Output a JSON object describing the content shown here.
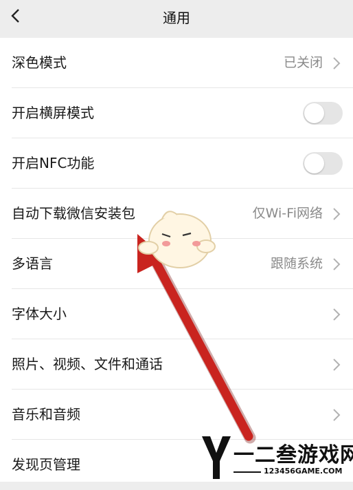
{
  "nav": {
    "title": "通用"
  },
  "rows": [
    {
      "label": "深色模式",
      "value": "已关闭",
      "control": "chevron"
    },
    {
      "label": "开启横屏模式",
      "control": "toggle",
      "toggle_on": false
    },
    {
      "label": "开启NFC功能",
      "control": "toggle",
      "toggle_on": false
    },
    {
      "label": "自动下载微信安装包",
      "value": "仅Wi-Fi网络",
      "control": "chevron"
    },
    {
      "label": "多语言",
      "value": "跟随系统",
      "control": "chevron"
    },
    {
      "label": "字体大小",
      "control": "chevron"
    },
    {
      "label": "照片、视频、文件和通话",
      "control": "chevron"
    },
    {
      "label": "音乐和音频",
      "control": "chevron"
    },
    {
      "label": "发现页管理",
      "control": "none"
    }
  ],
  "annotation": {
    "arrow_color": "#c9241f"
  },
  "watermark": {
    "text": "一二叁游戏网",
    "url": "123456GAME.COM"
  }
}
